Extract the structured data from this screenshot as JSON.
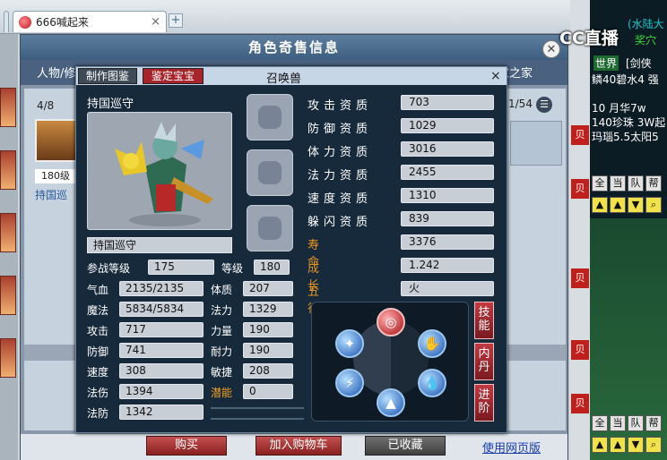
{
  "browser": {
    "tab_active": "666喊起来",
    "tab_inactive": "...",
    "new_tab": "+",
    "close": "×"
  },
  "cc_logo": "CC直播",
  "shop": {
    "title": "角色奇售信息",
    "tabs": [
      "人物/修",
      "家之家"
    ],
    "page_left": "4/8",
    "page_right": "1/54",
    "item_level": "180级",
    "item_name": "持国巡",
    "buttons": {
      "buy": "购买",
      "add_cart": "加入购物车",
      "favorited": "已收藏"
    },
    "web_link": "使用网页版"
  },
  "pet": {
    "title": "召唤兽",
    "tabs": [
      "制作图鉴",
      "鉴定宝宝"
    ],
    "name_top": "持国巡守",
    "name_field": "持国巡守",
    "level_labels": {
      "join_level": "参战等级",
      "level": "等级"
    },
    "join_level": "175",
    "level": "180",
    "stats_left": [
      {
        "label": "气血",
        "value": "2135/2135"
      },
      {
        "label": "魔法",
        "value": "5834/5834"
      },
      {
        "label": "攻击",
        "value": "717"
      },
      {
        "label": "防御",
        "value": "741"
      },
      {
        "label": "速度",
        "value": "308"
      },
      {
        "label": "法伤",
        "value": "1394"
      },
      {
        "label": "法防",
        "value": "1342"
      }
    ],
    "stats_mid": [
      {
        "label": "体质",
        "value": "207"
      },
      {
        "label": "法力",
        "value": "1329"
      },
      {
        "label": "力量",
        "value": "190"
      },
      {
        "label": "耐力",
        "value": "190"
      },
      {
        "label": "敏捷",
        "value": "208"
      },
      {
        "label": "潜能",
        "value": "0"
      }
    ],
    "aptitudes": [
      {
        "label": "攻击资质",
        "value": "703"
      },
      {
        "label": "防御资质",
        "value": "1029"
      },
      {
        "label": "体力资质",
        "value": "3016"
      },
      {
        "label": "法力资质",
        "value": "2455"
      },
      {
        "label": "速度资质",
        "value": "1310"
      },
      {
        "label": "躲闪资质",
        "value": "839"
      }
    ],
    "special": [
      {
        "label": "寿命",
        "value": "3376"
      },
      {
        "label": "成长",
        "value": "1.242"
      },
      {
        "label": "五行",
        "value": "火"
      }
    ],
    "side_buttons": [
      "技能",
      "内丹",
      "进阶"
    ],
    "close": "×"
  },
  "chat": {
    "lines": [
      "(水陆大",
      "奖穴",
      "世界",
      "[剑侠",
      "鳞40碧水4 强",
      "10 月华7w",
      "140珍珠 3W起",
      "玛瑙5.5太阳5"
    ],
    "controls_top": [
      "全",
      "当",
      "队",
      "帮"
    ],
    "controls_bottom": [
      "全",
      "当",
      "队",
      "帮"
    ]
  }
}
